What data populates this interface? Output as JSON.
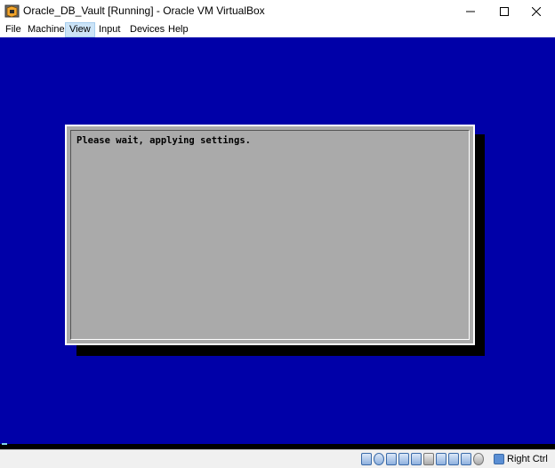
{
  "window": {
    "title": "Oracle_DB_Vault [Running] - Oracle VM VirtualBox",
    "app_icon": "virtualbox-icon",
    "controls": [
      "minimize-icon",
      "maximize-icon",
      "close-icon"
    ]
  },
  "menu": {
    "items": [
      "File",
      "Machine",
      "View",
      "Input",
      "Devices",
      "Help"
    ],
    "active": "View"
  },
  "vm_screen": {
    "background_color": "#0000a8",
    "dialog": {
      "message": "Please wait, applying settings.",
      "background_color": "#aaaaaa"
    }
  },
  "statusbar": {
    "icons": [
      "hard-disk-icon",
      "optical-drive-icon",
      "audio-icon",
      "network-icon",
      "usb-icon",
      "shared-folder-icon",
      "display-icon",
      "video-capture-icon",
      "cpu-icon",
      "mouse-integration-icon",
      "host-key-icon"
    ],
    "host_key_label": "Right Ctrl"
  }
}
